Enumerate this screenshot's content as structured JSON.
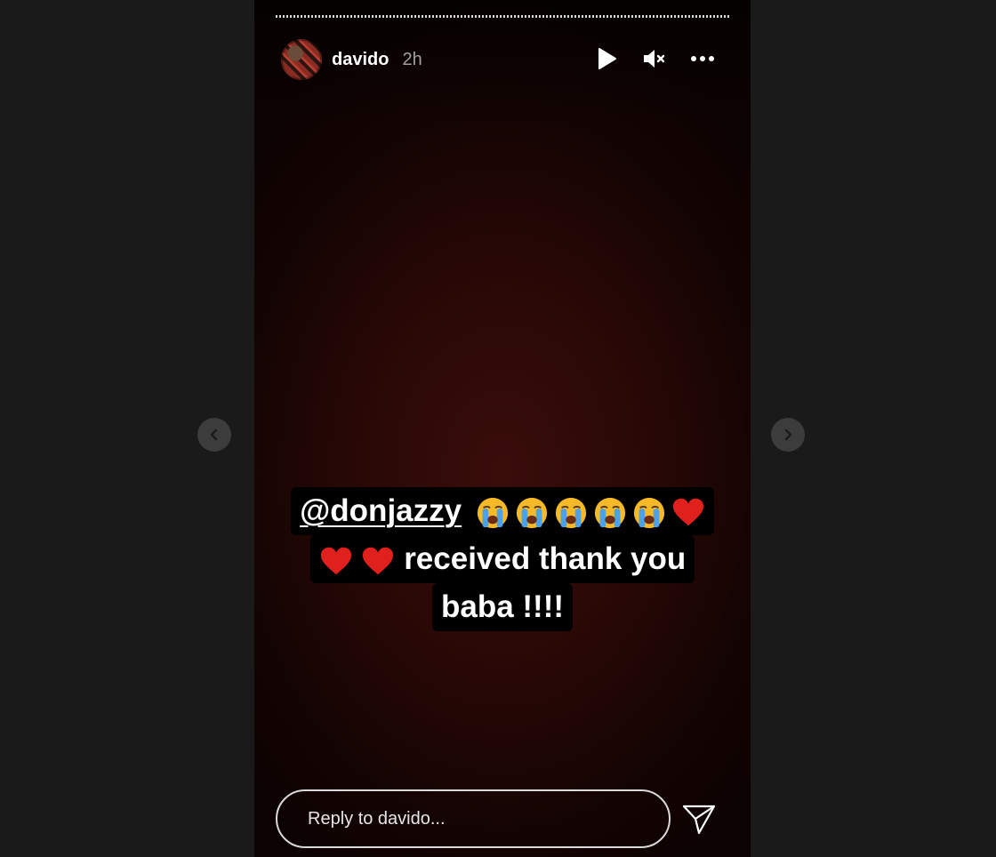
{
  "story": {
    "username": "davido",
    "time_ago": "2h",
    "text": {
      "mention": "@donjazzy",
      "line2_text": "received thank you",
      "line3_text": "baba !!!!"
    },
    "emoji": {
      "crying_count": 5,
      "hearts_line1": 1,
      "hearts_line2": 2
    }
  },
  "controls": {
    "play_icon": "play-icon",
    "mute_icon": "muted-speaker-icon",
    "more_icon": "more-horizontal-icon"
  },
  "reply": {
    "placeholder": "Reply to davido..."
  },
  "colors": {
    "background": "#1a1a1a",
    "story_bg": "#270806",
    "heart": "#e0201c",
    "emoji_face": "#f6b928",
    "tears": "#4aa3e8"
  }
}
